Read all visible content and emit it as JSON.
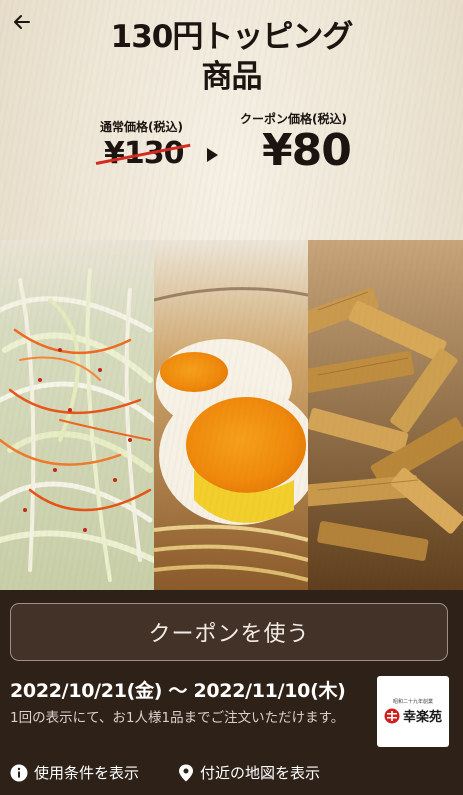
{
  "header": {
    "back_icon": "arrow-left-icon",
    "title_line1": "130円トッピング",
    "title_line2": "商品"
  },
  "prices": {
    "normal_label": "通常価格(税込)",
    "normal_price": "¥130",
    "coupon_label": "クーポン価格(税込)",
    "coupon_price": "¥80",
    "strike_color": "#d62a20"
  },
  "food_images": [
    {
      "icon": "green-onion-topping-photo"
    },
    {
      "icon": "seasoned-egg-topping-photo"
    },
    {
      "icon": "menma-bamboo-shoot-topping-photo"
    }
  ],
  "actions": {
    "use_coupon_label": "クーポンを使う"
  },
  "offer": {
    "period": "2022/10/21(金) 〜 2022/11/10(木)",
    "note": "1回の表示にて、お1人様1品までご注文いただけます。"
  },
  "shop_logo": {
    "name": "幸楽苑",
    "tagline": "昭和二十九年創業"
  },
  "footer_links": {
    "terms_label": "使用条件を表示",
    "terms_icon": "info-icon",
    "map_label": "付近の地図を表示",
    "map_icon": "location-pin-icon"
  },
  "colors": {
    "background_dark": "#2e2118",
    "button_bg": "#433228",
    "logo_red": "#cc1f1f"
  }
}
